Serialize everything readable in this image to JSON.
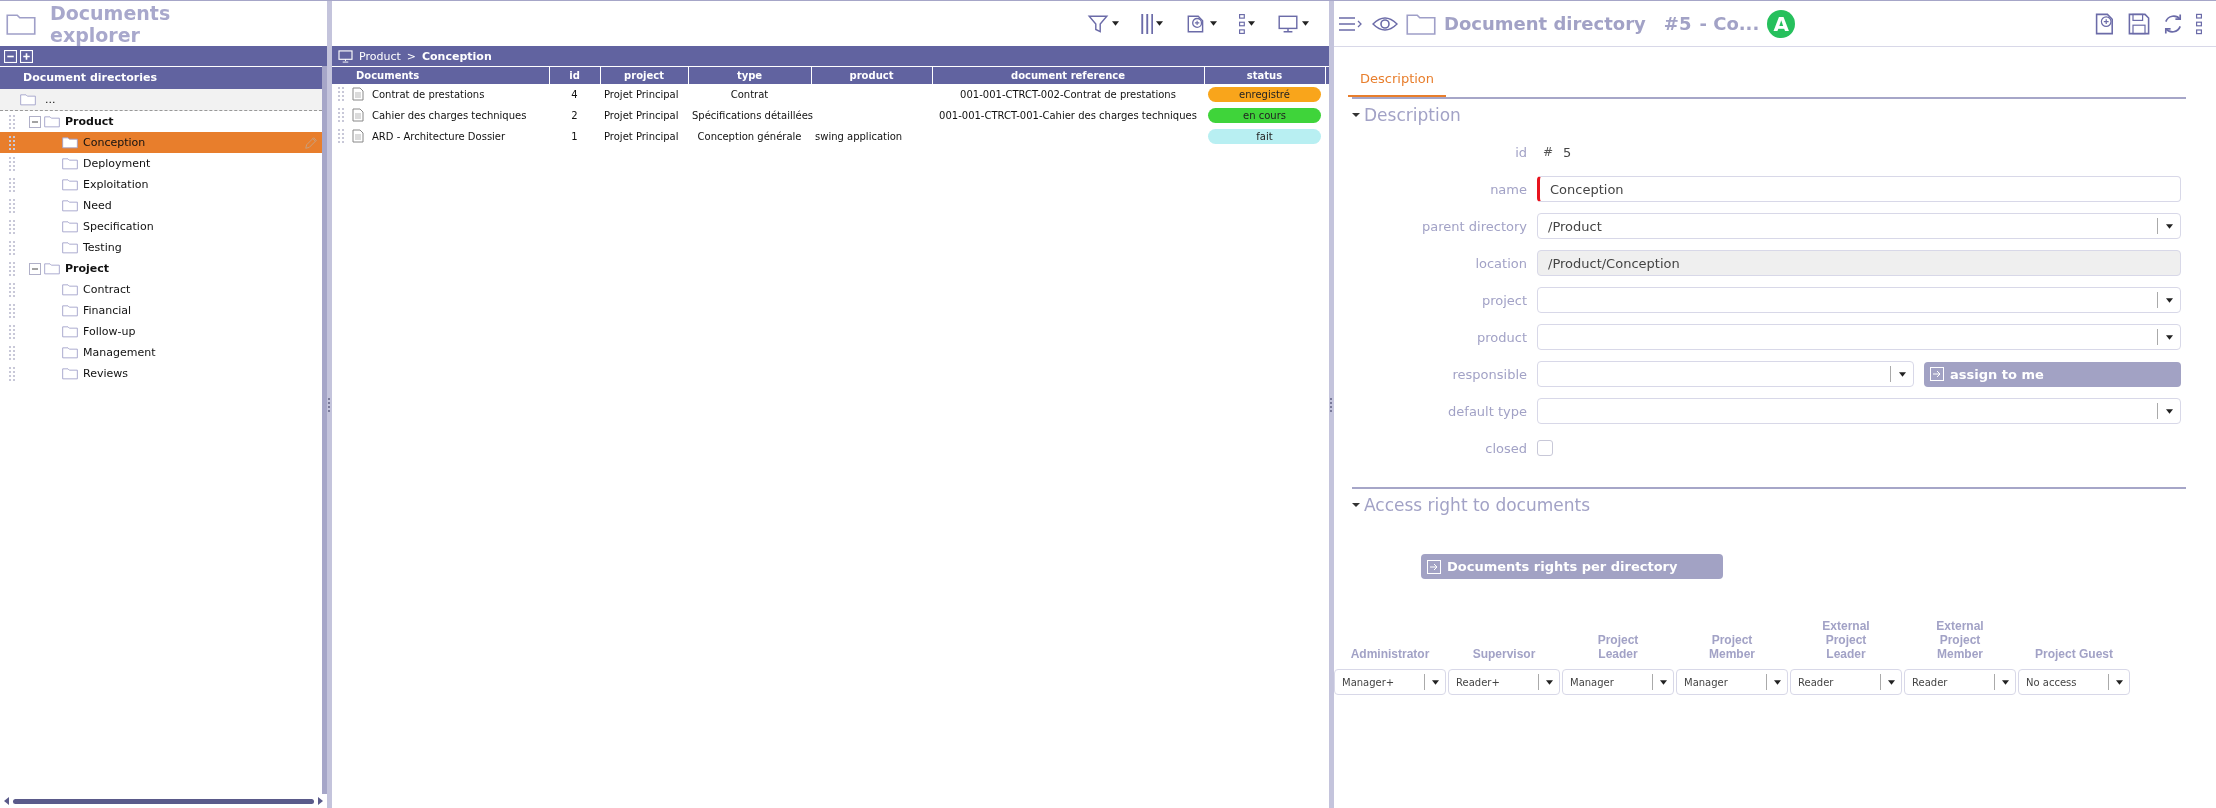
{
  "explorer": {
    "title": "Documents explorer"
  },
  "tree": {
    "header": "Document directories",
    "root": "...",
    "items": [
      {
        "label": "Product",
        "selected": false,
        "expanded": true,
        "children": [
          {
            "label": "Conception",
            "selected": true
          },
          {
            "label": "Deployment",
            "selected": false
          },
          {
            "label": "Exploitation",
            "selected": false
          },
          {
            "label": "Need",
            "selected": false
          },
          {
            "label": "Specification",
            "selected": false
          },
          {
            "label": "Testing",
            "selected": false
          }
        ]
      },
      {
        "label": "Project",
        "selected": false,
        "expanded": true,
        "children": [
          {
            "label": "Contract",
            "selected": false
          },
          {
            "label": "Financial",
            "selected": false
          },
          {
            "label": "Follow-up",
            "selected": false
          },
          {
            "label": "Management",
            "selected": false
          },
          {
            "label": "Reviews",
            "selected": false
          }
        ]
      }
    ]
  },
  "documents": {
    "breadcrumb": [
      "Product",
      "Conception"
    ],
    "breadcrumb_separator": ">",
    "columns": [
      "Documents",
      "id",
      "project",
      "type",
      "product",
      "document reference",
      "status"
    ],
    "rows": [
      {
        "title": "Contrat de prestations",
        "id": "4",
        "project": "Projet Principal",
        "type": "Contrat",
        "product": "",
        "reference": "001-001-CTRCT-002-Contrat de prestations",
        "status": {
          "label": "enregistré",
          "color": "#f9a51b"
        }
      },
      {
        "title": "Cahier des charges techniques",
        "id": "2",
        "project": "Projet Principal",
        "type": "Spécifications détaillées",
        "product": "",
        "reference": "001-001-CTRCT-001-Cahier des charges techniques",
        "status": {
          "label": "en cours",
          "color": "#3fd43a"
        }
      },
      {
        "title": "ARD - Architecture Dossier",
        "id": "1",
        "project": "Projet Principal",
        "type": "Conception générale",
        "product": "swing application",
        "reference": "",
        "status": {
          "label": "fait",
          "color": "#b8eff2"
        }
      }
    ]
  },
  "detail": {
    "title": "Document directory",
    "number": "#5",
    "suffix": "- Co...",
    "badge": "A",
    "tabs": [
      {
        "label": "Description",
        "selected": true
      }
    ],
    "description": {
      "title": "Description",
      "expanded": true,
      "fields": [
        {
          "label": "id",
          "kind": "id",
          "prefix": "#",
          "value": "5"
        },
        {
          "label": "name",
          "kind": "text",
          "value": "Conception",
          "required": true
        },
        {
          "label": "parent directory",
          "kind": "select",
          "value": "/Product",
          "required": false
        },
        {
          "label": "location",
          "kind": "readonly",
          "value": "/Product/Conception"
        },
        {
          "label": "project",
          "kind": "select",
          "required": false
        },
        {
          "label": "product",
          "kind": "select",
          "required": false
        },
        {
          "label": "responsible",
          "kind": "assign",
          "required": false,
          "action": "assign to me"
        },
        {
          "label": "default type",
          "kind": "select",
          "required": false
        },
        {
          "label": "closed",
          "kind": "checkbox",
          "checked": false
        }
      ]
    },
    "access": {
      "title": "Access right to documents",
      "expanded": true,
      "button": "Documents rights per directory",
      "roles": [
        {
          "name": "Administrator",
          "value": "Manager+"
        },
        {
          "name": "Supervisor",
          "value": "Reader+"
        },
        {
          "name": "Project Leader",
          "value": "Manager"
        },
        {
          "name": "Project Member",
          "value": "Manager"
        },
        {
          "name": "External Project Leader",
          "value": "Reader"
        },
        {
          "name": "External Project Member",
          "value": "Reader"
        },
        {
          "name": "Project Guest",
          "value": "No access"
        }
      ]
    }
  }
}
